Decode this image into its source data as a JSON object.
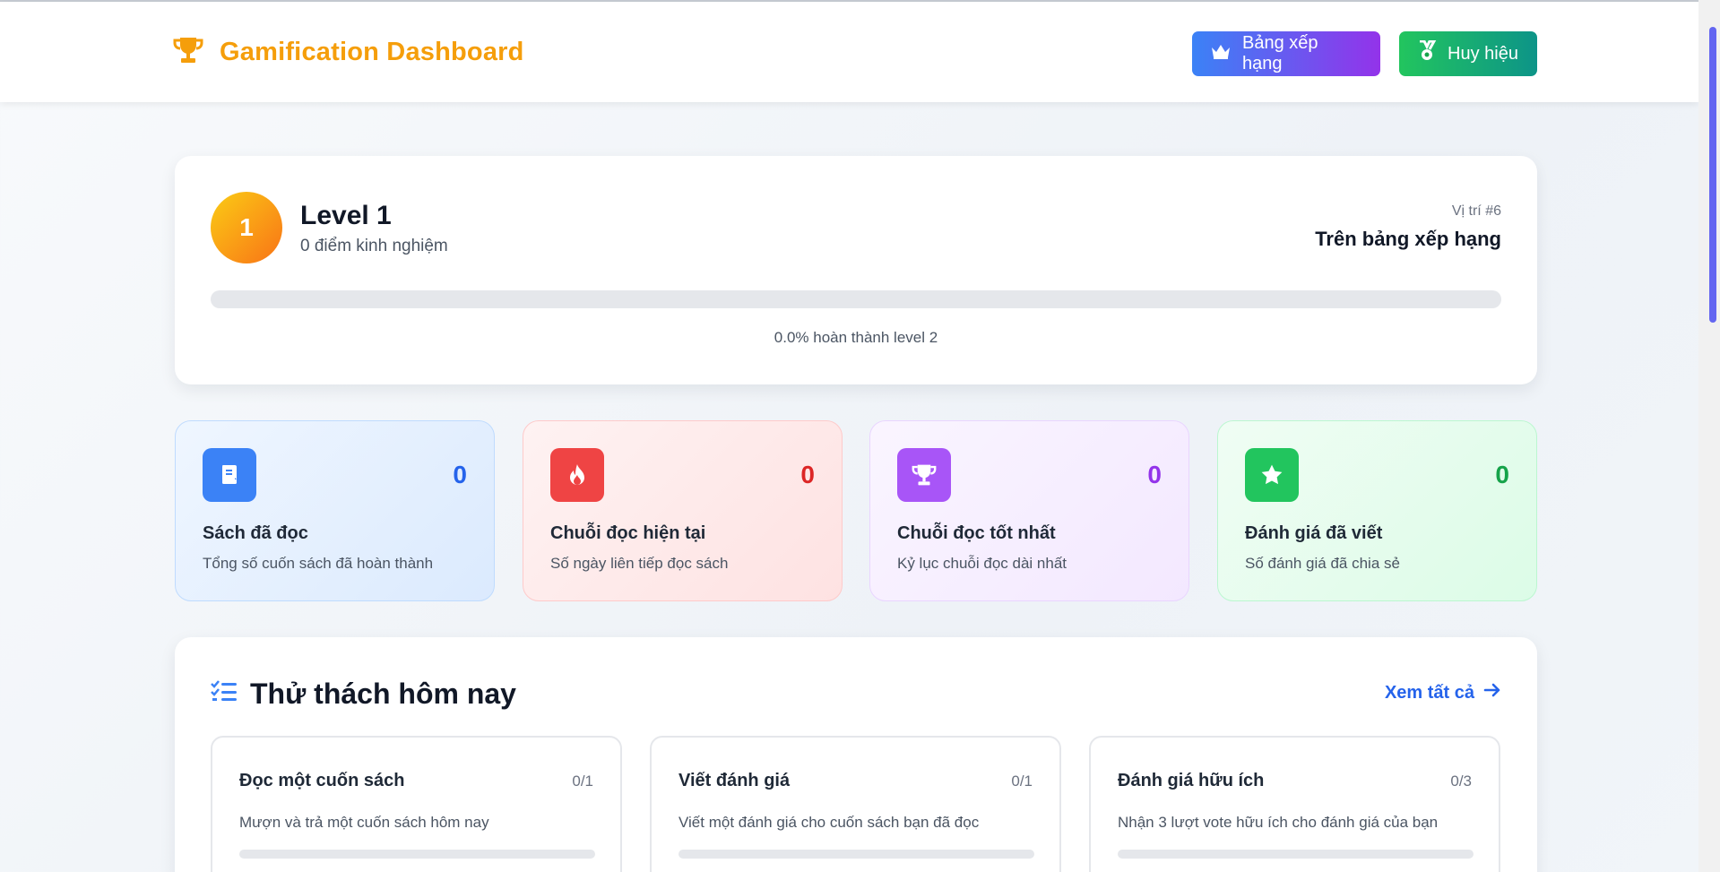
{
  "header": {
    "title": "Gamification Dashboard",
    "buttons": {
      "leaderboard": "Bảng xếp hạng",
      "badges": "Huy hiệu"
    }
  },
  "level": {
    "number": "1",
    "title": "Level 1",
    "xp": "0 điểm kinh nghiệm",
    "rank_position": "Vị trí #6",
    "rank_label": "Trên bảng xếp hạng",
    "progress_percent": 0,
    "progress_text": "0.0% hoàn thành level 2"
  },
  "stats": [
    {
      "value": "0",
      "label": "Sách đã đọc",
      "desc": "Tổng số cuốn sách đã hoàn thành",
      "icon": "book-icon"
    },
    {
      "value": "0",
      "label": "Chuỗi đọc hiện tại",
      "desc": "Số ngày liên tiếp đọc sách",
      "icon": "fire-icon"
    },
    {
      "value": "0",
      "label": "Chuỗi đọc tốt nhất",
      "desc": "Kỷ lục chuỗi đọc dài nhất",
      "icon": "trophy-icon"
    },
    {
      "value": "0",
      "label": "Đánh giá đã viết",
      "desc": "Số đánh giá đã chia sẻ",
      "icon": "star-icon"
    }
  ],
  "challenges": {
    "title": "Thử thách hôm nay",
    "view_all": "Xem tất cả",
    "items": [
      {
        "title": "Đọc một cuốn sách",
        "count": "0/1",
        "desc": "Mượn và trả một cuốn sách hôm nay"
      },
      {
        "title": "Viết đánh giá",
        "count": "0/1",
        "desc": "Viết một đánh giá cho cuốn sách bạn đã đọc"
      },
      {
        "title": "Đánh giá hữu ích",
        "count": "0/3",
        "desc": "Nhận 3 lượt vote hữu ích cho đánh giá của bạn"
      }
    ]
  },
  "colors": {
    "brand": "#f59e0b",
    "link": "#2563eb"
  }
}
